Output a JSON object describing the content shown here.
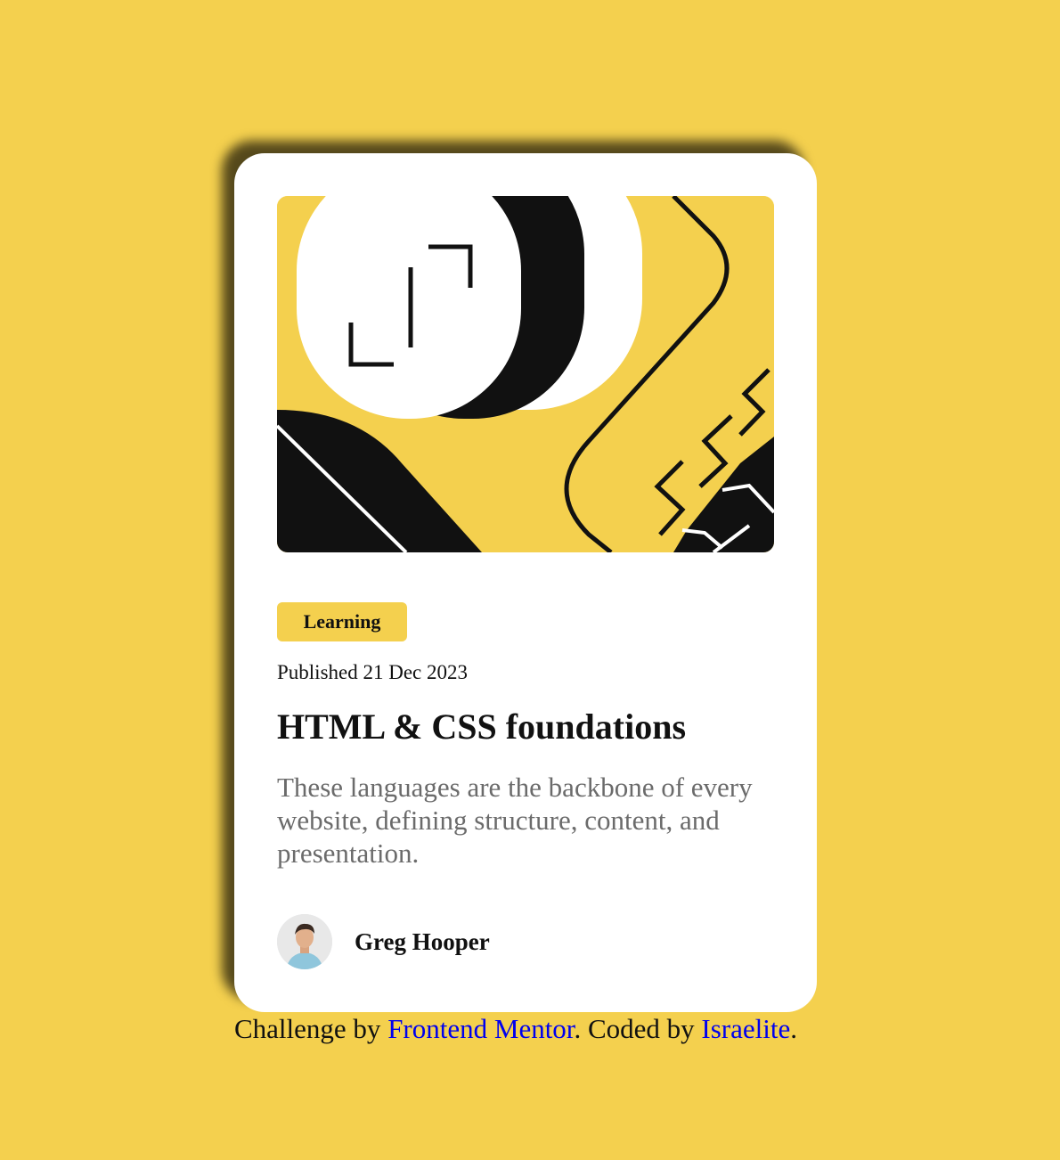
{
  "card": {
    "tag_label": "Learning",
    "published": "Published 21 Dec 2023",
    "title": "HTML & CSS foundations",
    "description": "These languages are the backbone of every website, defining structure, content, and presentation.",
    "author_name": "Greg Hooper",
    "hero_image_icon": "abstract-illustration",
    "avatar_icon": "avatar-photo"
  },
  "attribution": {
    "prefix": "Challenge by ",
    "link1": "Frontend Mentor",
    "middle": ". Coded by ",
    "link2": "Israelite",
    "suffix": "."
  },
  "colors": {
    "background": "#f4d04e",
    "card": "#ffffff",
    "text": "#111111",
    "description": "#6b6b6b",
    "link": "#0000ee"
  }
}
